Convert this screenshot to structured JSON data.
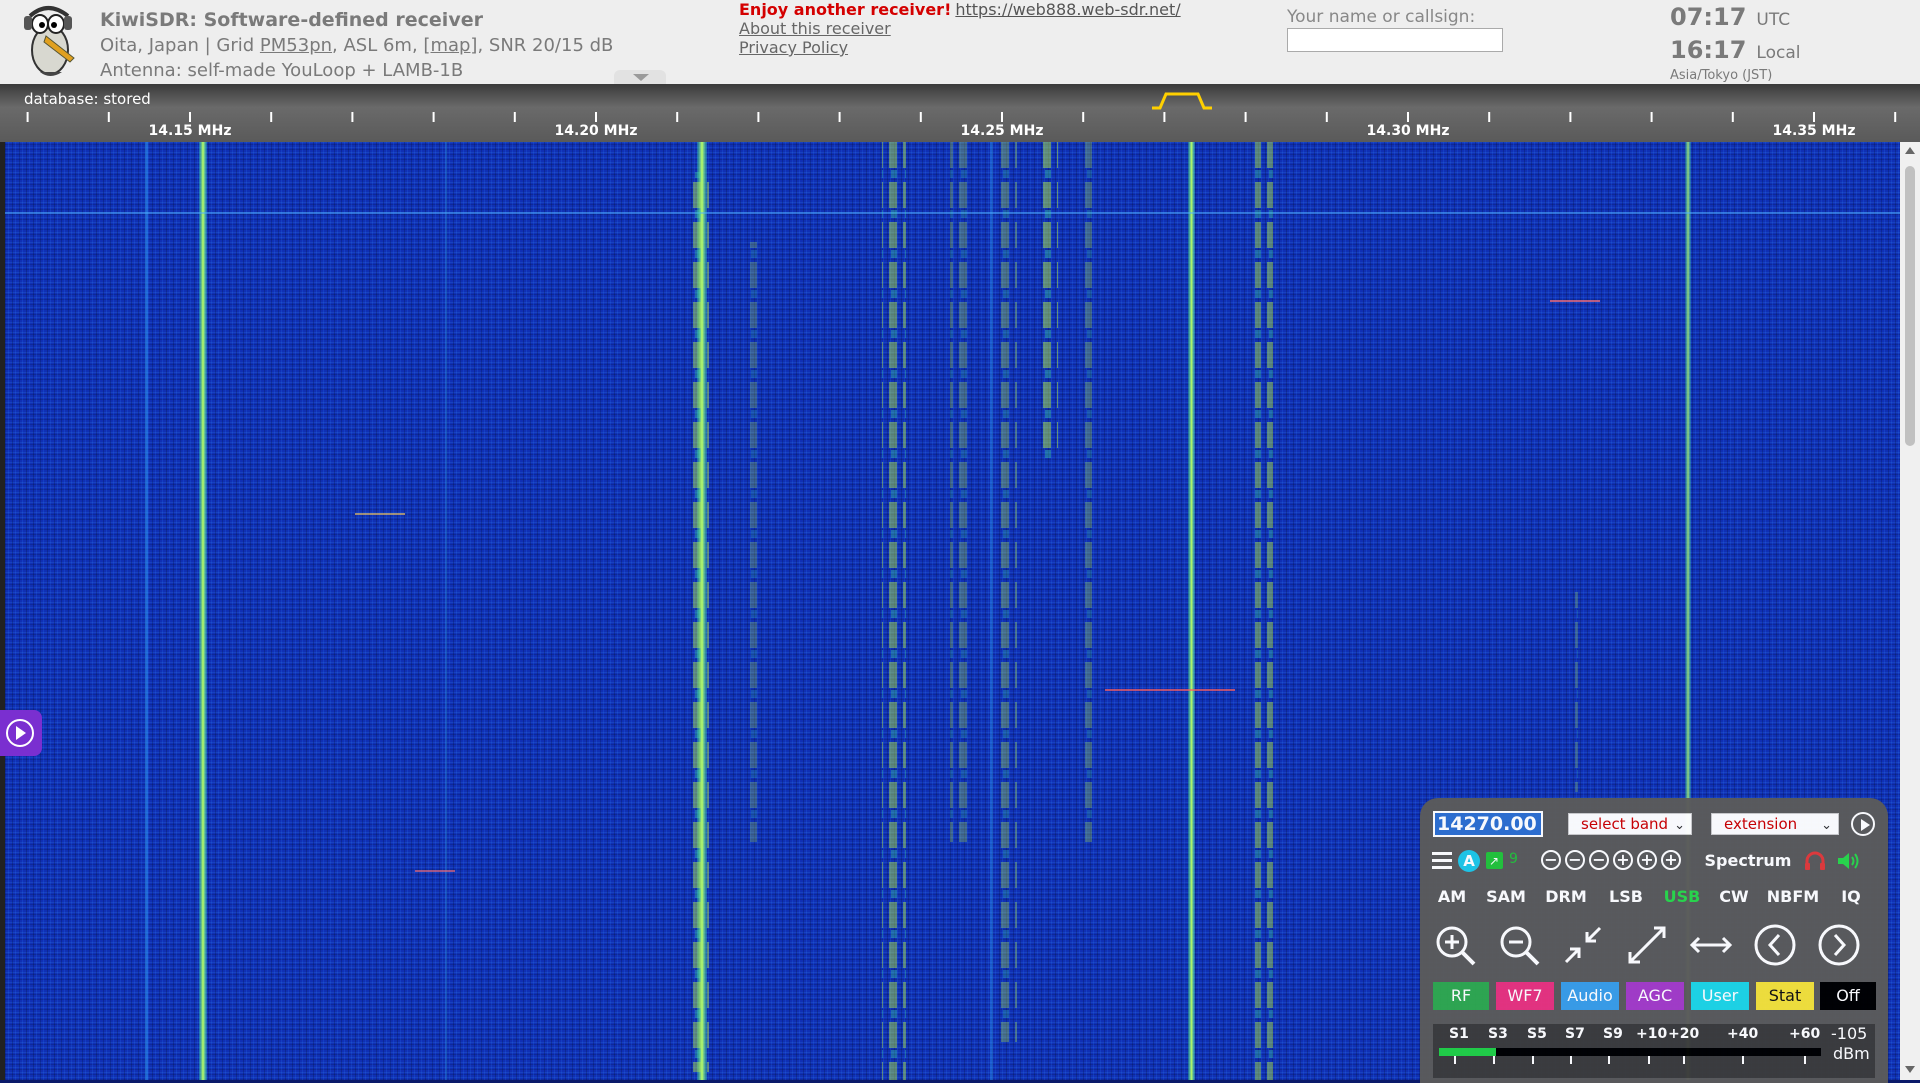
{
  "header": {
    "title": "KiwiSDR: Software-defined receiver",
    "location_text": "Oita, Japan | Grid ",
    "grid": "PM53pn",
    "asl_text": ", ASL 6m, ",
    "map_link": "[map]",
    "snr_text": ", SNR 20/15 dB",
    "antenna": "Antenna: self-made YouLoop + LAMB-1B",
    "enjoy": "Enjoy another receiver!",
    "other_url": "https://web888.web-sdr.net/",
    "about_link": "About this receiver",
    "privacy_link": "Privacy Policy",
    "name_label": "Your name or callsign:",
    "name_value": "",
    "utc_time": "07:17",
    "utc_label": "UTC",
    "local_time": "16:17",
    "local_label": "Local",
    "timezone": "Asia/Tokyo (JST)"
  },
  "scale": {
    "database_label": "database: stored",
    "freq_labels": [
      "14.15 MHz",
      "14.20 MHz",
      "14.25 MHz",
      "14.30 MHz",
      "14.35 MHz"
    ]
  },
  "panel": {
    "frequency": "14270.00",
    "band_select": "select band",
    "extension_select": "extension",
    "a_badge": "A",
    "nine": "9",
    "spectrum": "Spectrum",
    "modes": [
      "AM",
      "SAM",
      "DRM",
      "LSB",
      "USB",
      "CW",
      "NBFM",
      "IQ"
    ],
    "active_mode": "USB",
    "tabs": [
      {
        "label": "RF",
        "bg": "#2fa84f",
        "fg": "#ffffff"
      },
      {
        "label": "WF7",
        "bg": "#e8337f",
        "fg": "#ffffff"
      },
      {
        "label": "Audio",
        "bg": "#3a9ee8",
        "fg": "#ffffff"
      },
      {
        "label": "AGC",
        "bg": "#a43cc8",
        "fg": "#ffffff"
      },
      {
        "label": "User",
        "bg": "#1ed6e6",
        "fg": "#ffffff"
      },
      {
        "label": "Stat",
        "bg": "#f4e23a",
        "fg": "#111111"
      },
      {
        "label": "Off",
        "bg": "#000000",
        "fg": "#ffffff"
      }
    ],
    "smeter_labels": [
      "S1",
      "S3",
      "S5",
      "S7",
      "S9",
      "+10",
      "+20",
      "+40",
      "+60"
    ],
    "smeter_dbm_value": "-105",
    "smeter_dbm_unit": "dBm",
    "smeter_level_fraction": 0.15
  },
  "colors": {
    "accent_green": "#29d84a",
    "waterfall_bg": "#1030b4",
    "panel_bg": "#5b5b5b"
  }
}
